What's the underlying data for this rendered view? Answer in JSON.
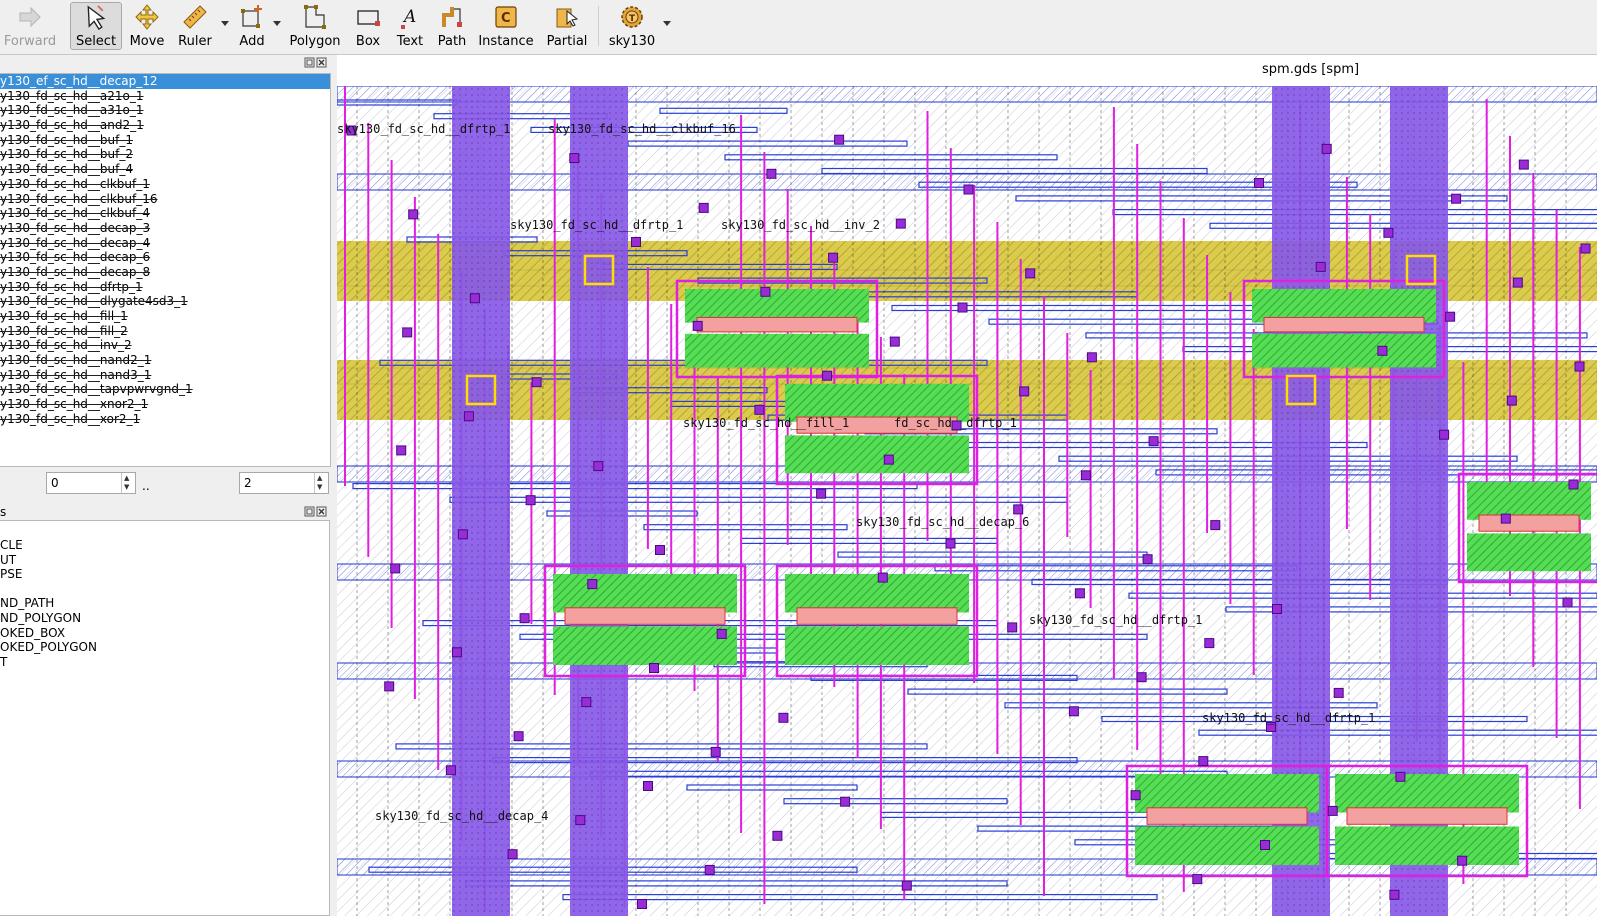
{
  "toolbar": {
    "forward": "Forward",
    "select": "Select",
    "move": "Move",
    "ruler": "Ruler",
    "add": "Add",
    "polygon": "Polygon",
    "box": "Box",
    "text": "Text",
    "path": "Path",
    "instance": "Instance",
    "partial": "Partial",
    "tech": "sky130"
  },
  "cells": [
    "y130_ef_sc_hd__decap_12",
    "y130_fd_sc_hd__a21o_1",
    "y130_fd_sc_hd__a31o_1",
    "y130_fd_sc_hd__and2_1",
    "y130_fd_sc_hd__buf_1",
    "y130_fd_sc_hd__buf_2",
    "y130_fd_sc_hd__buf_4",
    "y130_fd_sc_hd__clkbuf_1",
    "y130_fd_sc_hd__clkbuf_16",
    "y130_fd_sc_hd__clkbuf_4",
    "y130_fd_sc_hd__decap_3",
    "y130_fd_sc_hd__decap_4",
    "y130_fd_sc_hd__decap_6",
    "y130_fd_sc_hd__decap_8",
    "y130_fd_sc_hd__dfrtp_1",
    "y130_fd_sc_hd__dlygate4sd3_1",
    "y130_fd_sc_hd__fill_1",
    "y130_fd_sc_hd__fill_2",
    "y130_fd_sc_hd__inv_2",
    "y130_fd_sc_hd__nand2_1",
    "y130_fd_sc_hd__nand3_1",
    "y130_fd_sc_hd__tapvpwrvgnd_1",
    "y130_fd_sc_hd__xnor2_1",
    "y130_fd_sc_hd__xor2_1"
  ],
  "hier": {
    "from": "0",
    "range_sep": "..",
    "to": "2"
  },
  "types_header": "s",
  "types": [
    "CLE",
    "UT",
    "PSE",
    "",
    "ND_PATH",
    "ND_POLYGON",
    "OKED_BOX",
    "OKED_POLYGON",
    "T"
  ],
  "canvas": {
    "title": "spm.gds [spm]",
    "cell_labels": [
      "sky130_fd_sc_hd__dfrtp_1",
      "sky130_fd_sc_hd__dfrtp_1",
      "sky130_fd_sc_hd__fill_1",
      "sky130_fd_sc_hd__decap_6",
      "sky130_fd_sc_hd__dfrtp_1",
      "sky130_fd_sc_hd__dfrtp_1",
      "sky130_fd_sc_hd__decap_4",
      "sky130_fd_sc_hd__clkbuf_16",
      "sky130_fd_sc_hd__inv_2",
      "fd_sc_hd__dfrtp_1"
    ]
  },
  "colors": {
    "selection": "#3a8fd9",
    "well_purple": "#7b4fe0",
    "metal_blue": "#3344dd",
    "poly_magenta": "#e020e0",
    "diff_green": "#33cc33",
    "nwell_yellow": "#d4c21a",
    "via_purple": "#8a22cc"
  }
}
